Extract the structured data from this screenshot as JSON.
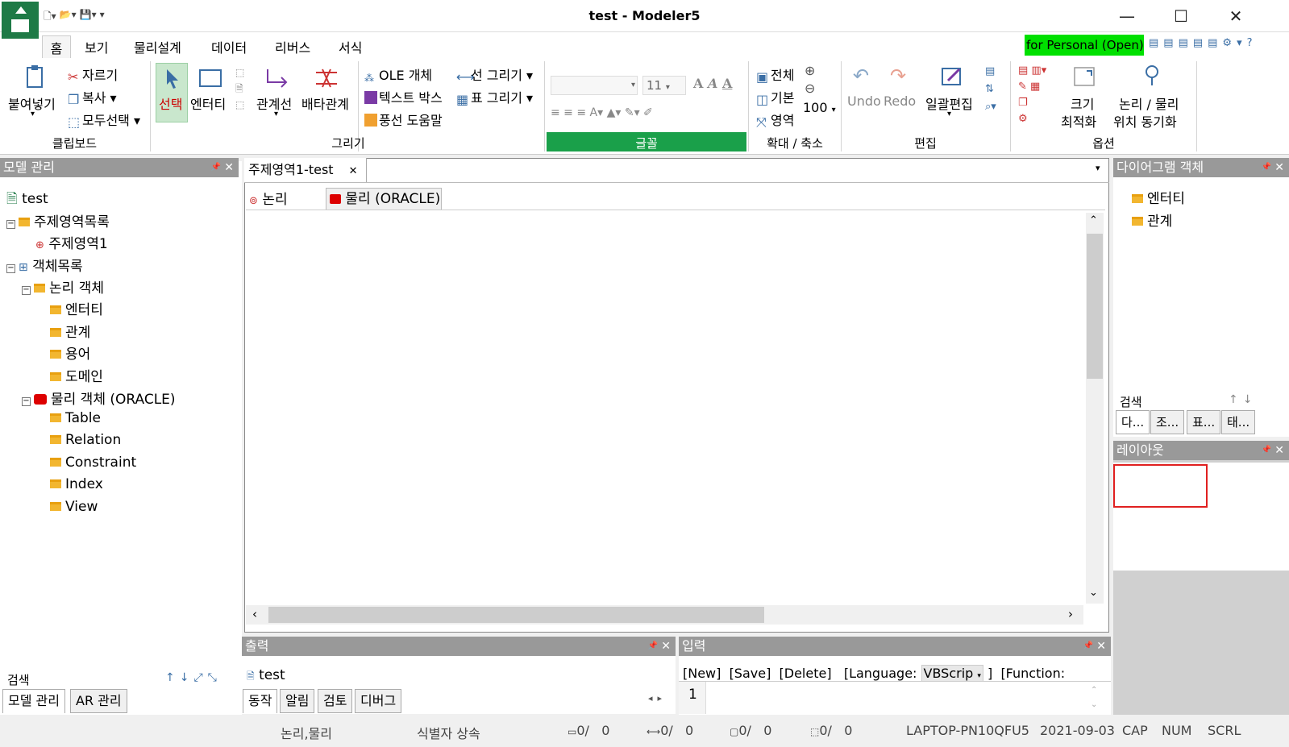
{
  "window": {
    "title": "test - Modeler5",
    "minimize": "—",
    "maximize": "☐",
    "close": "✕"
  },
  "qat": [
    "🗋▾",
    "📂▾",
    "💾▾",
    "▾"
  ],
  "tabs": {
    "home": "홈",
    "view": "보기",
    "physical": "물리설계",
    "data": "데이터",
    "reverse": "리버스",
    "format": "서식"
  },
  "personal_badge": "for Personal (Open)",
  "ribbon": {
    "clipboard": {
      "paste": "붙여넣기",
      "cut": "자르기",
      "copy": "복사",
      "select_all": "모두선택",
      "label": "클립보드"
    },
    "draw": {
      "select": "선택",
      "entity": "엔터티",
      "relation_line": "관계선",
      "exclusive": "배타관계",
      "ole": "OLE 개체",
      "textbox": "텍스트 박스",
      "balloon": "풍선 도움말",
      "line": "선 그리기",
      "table": "표 그리기",
      "label": "그리기"
    },
    "font": {
      "size": "11",
      "label": "글꼴"
    },
    "zoom": {
      "all": "전체",
      "default": "기본",
      "area": "영역",
      "value": "100",
      "label": "확대 / 축소"
    },
    "edit": {
      "undo": "Undo",
      "redo": "Redo",
      "batch": "일괄편집",
      "label": "편집"
    },
    "options": {
      "size_opt_1": "크기",
      "size_opt_2": "최적화",
      "sync_1": "논리 / 물리",
      "sync_2": "위치 동기화",
      "label": "옵션"
    }
  },
  "left_panel": {
    "title": "모델 관리",
    "tree": {
      "root": "test",
      "subject_list": "주제영역목록",
      "subject1": "주제영역1",
      "object_list": "객체목록",
      "logical": "논리 객체",
      "entity": "엔터티",
      "relation": "관계",
      "term": "용어",
      "domain": "도메인",
      "physical": "물리 객체 (ORACLE)",
      "table": "Table",
      "relation_p": "Relation",
      "constraint": "Constraint",
      "index": "Index",
      "view": "View"
    },
    "search": "검색",
    "tabs": [
      "모델 관리",
      "AR 관리"
    ]
  },
  "document": {
    "tab": "주제영역1-test",
    "subtab_logical": "논리",
    "subtab_physical": "물리 (ORACLE)"
  },
  "right_panel": {
    "title": "다이어그램 객체",
    "items": [
      "엔터티",
      "관계"
    ],
    "search": "검색",
    "tabs": [
      "다...",
      "조...",
      "표...",
      "태..."
    ],
    "layout_title": "레이아웃"
  },
  "output": {
    "title": "출력",
    "line": "test",
    "tabs": [
      "동작",
      "알림",
      "검토",
      "디버그"
    ]
  },
  "input": {
    "title": "입력",
    "toolbar_new": "[New]",
    "toolbar_save": "[Save]",
    "toolbar_delete": "[Delete]",
    "toolbar_lang": "[Language:",
    "lang_value": "VBScrip",
    "toolbar_close": "]",
    "toolbar_func": "[Function:",
    "line_number": "1"
  },
  "status": {
    "mode": "논리,물리",
    "inherit": "식별자 상속",
    "count1": "0/",
    "count1b": "0",
    "count2": "0/",
    "count2b": "0",
    "count3": "0/",
    "count3b": "0",
    "count4": "0/",
    "count4b": "0",
    "host": "LAPTOP-PN10QFU5",
    "date": "2021-09-03",
    "cap": "CAP",
    "num": "NUM",
    "scrl": "SCRL"
  },
  "colors": {
    "brand": "#1e7a46",
    "badge": "#00e000",
    "font_group": "#1aa04a",
    "panel_header": "#999999"
  }
}
